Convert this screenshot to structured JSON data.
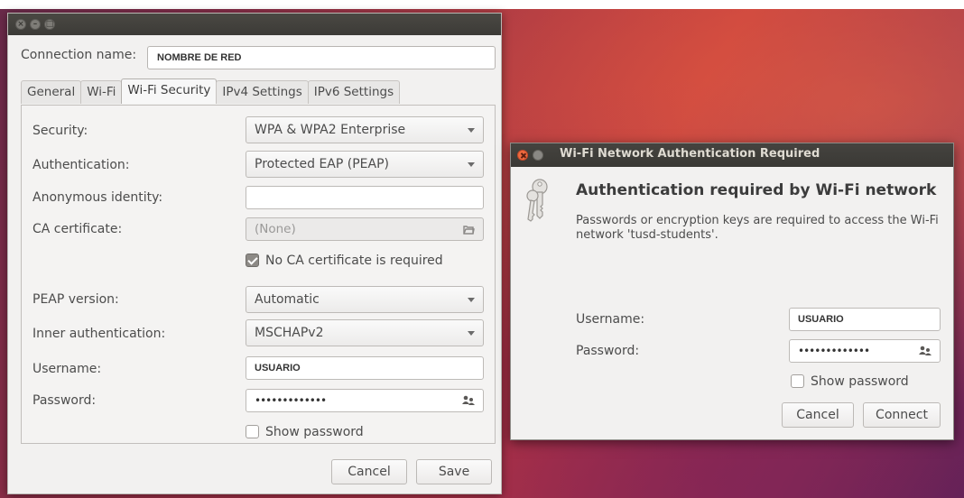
{
  "main_window": {
    "connection_name_label": "Connection name:",
    "connection_name_value": "NOMBRE DE RED",
    "tabs": [
      {
        "label": "General"
      },
      {
        "label": "Wi-Fi"
      },
      {
        "label": "Wi-Fi Security",
        "active": true
      },
      {
        "label": "IPv4 Settings"
      },
      {
        "label": "IPv6 Settings"
      }
    ],
    "form": {
      "security_label": "Security:",
      "security_value": "WPA & WPA2 Enterprise",
      "authentication_label": "Authentication:",
      "authentication_value": "Protected EAP (PEAP)",
      "anonymous_identity_label": "Anonymous identity:",
      "anonymous_identity_value": "",
      "ca_certificate_label": "CA certificate:",
      "ca_certificate_value": "(None)",
      "no_ca_required_label": "No CA certificate is required",
      "no_ca_required_checked": true,
      "peap_version_label": "PEAP version:",
      "peap_version_value": "Automatic",
      "inner_auth_label": "Inner authentication:",
      "inner_auth_value": "MSCHAPv2",
      "username_label": "Username:",
      "username_value": "USUARIO",
      "password_label": "Password:",
      "password_value": "•••••••••••••",
      "show_password_label": "Show password",
      "show_password_checked": false
    },
    "cancel_label": "Cancel",
    "save_label": "Save"
  },
  "auth_dialog": {
    "title": "Wi-Fi Network Authentication Required",
    "heading": "Authentication required by Wi-Fi network",
    "description": "Passwords or encryption keys are required to access the Wi-Fi network 'tusd-students'.",
    "username_label": "Username:",
    "username_value": "USUARIO",
    "password_label": "Password:",
    "password_value": "•••••••••••••",
    "show_password_label": "Show password",
    "show_password_checked": false,
    "cancel_label": "Cancel",
    "connect_label": "Connect"
  },
  "colors": {
    "titlebar": "#3c3b37",
    "window_bg": "#f2f1f0",
    "close_button": "#ef6a3e",
    "desktop_accent": "#c2393c"
  }
}
